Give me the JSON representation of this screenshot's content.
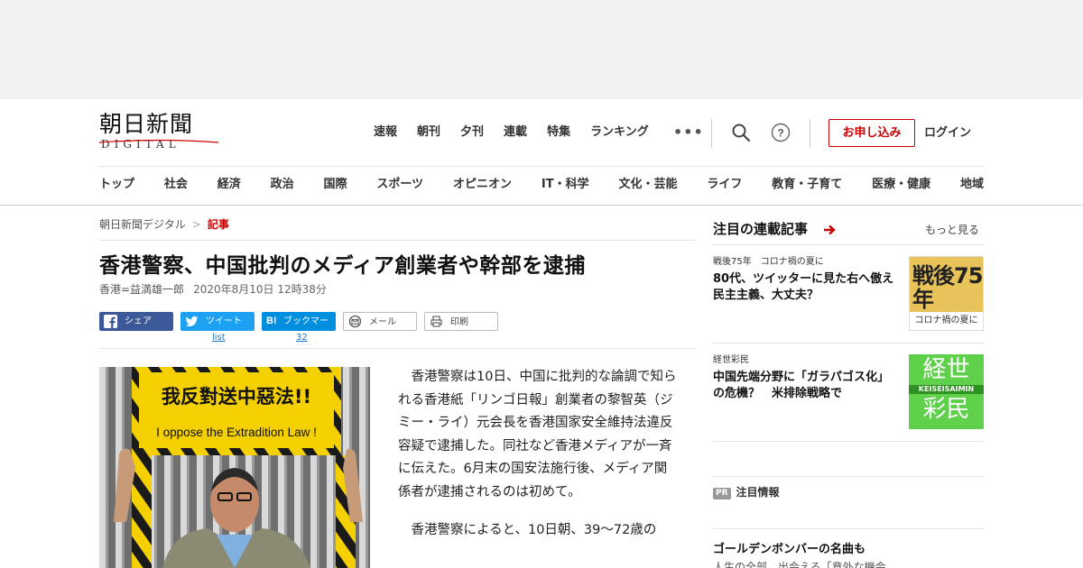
{
  "header": {
    "logo_main": "朝日新聞",
    "logo_sub": "DIGITAL",
    "top_nav": [
      "速報",
      "朝刊",
      "夕刊",
      "連載",
      "特集",
      "ランキング"
    ],
    "more_label": "•••",
    "subscribe_label": "お申し込み",
    "login_label": "ログイン",
    "categories": [
      "トップ",
      "社会",
      "経済",
      "政治",
      "国際",
      "スポーツ",
      "オピニオン",
      "IT・科学",
      "文化・芸能",
      "ライフ",
      "教育・子育て",
      "医療・健康",
      "地域"
    ],
    "accent_color": "#cc0000"
  },
  "breadcrumb": {
    "home": "朝日新聞デジタル",
    "separator": ">",
    "current": "記事"
  },
  "article": {
    "headline": "香港警察、中国批判のメディア創業者や幹部を逮捕",
    "author": "香港=益満雄一郎",
    "date": "2020年8月10日 12時38分",
    "paragraphs": [
      "香港警察は10日、中国に批判的な論調で知られる香港紙「リンゴ日報」創業者の黎智英（ジミー・ライ）元会長を香港国家安全維持法違反容疑で逮捕した。同社など香港メディアが一斉に伝えた。6月末の国安法施行後、メディア関係者が逮捕されるのは初めて。",
      "香港警察によると、10日朝、39～72歳の"
    ],
    "photo": {
      "sign_cn": "我反對送中惡法!!",
      "sign_en": "I oppose the Extradition Law !"
    }
  },
  "share": {
    "facebook_label": "シェア",
    "twitter_label": "ツイート",
    "hatena_label": "ブックマーク",
    "hatena_icon_text": "B!",
    "mail_label": "メール",
    "print_label": "印刷",
    "twitter_count": "list",
    "hatena_count": "32"
  },
  "sidebar": {
    "title": "注目の連載記事",
    "more_label": "もっと見る",
    "items": [
      {
        "kicker": "戦後75年　コロナ禍の夏に",
        "headline": "80代、ツイッターに見た右へ傲え　民主主義、大丈夫？",
        "thumb_main": "戦後75年",
        "thumb_sub": "コロナ禍の夏に"
      },
      {
        "kicker": "経世彩民",
        "headline": "中国先端分野に「ガラパゴス化」の危機？　米排除戦略で",
        "thumb_top": "経世",
        "thumb_mid": "KEISEISAIMIN",
        "thumb_bottom": "彩民"
      }
    ],
    "pr_badge": "PR",
    "pr_label": "注目情報",
    "pr_item_title": "ゴールデンボンバーの名曲も",
    "pr_item_sub": "人生の全部、出会える「意外な機会"
  }
}
